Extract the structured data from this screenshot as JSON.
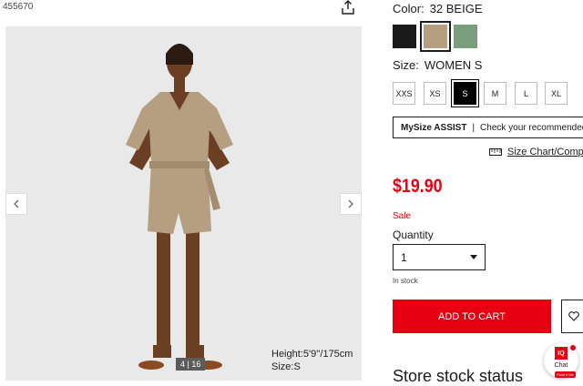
{
  "product_id": "455670",
  "gallery": {
    "counter": "4 | 16",
    "model_height": "Height:5'9''/175cm",
    "model_size": "Size:S",
    "prev_icon": "chevron-left-icon",
    "next_icon": "chevron-right-icon"
  },
  "color": {
    "label": "Color:",
    "value": "32 BEIGE",
    "swatches": [
      {
        "name": "black",
        "hex": "#1a1a1a"
      },
      {
        "name": "beige",
        "hex": "#b59f80",
        "selected": true
      },
      {
        "name": "green",
        "hex": "#7a9e7e"
      }
    ]
  },
  "size": {
    "label": "Size:",
    "value": "WOMEN S",
    "options": [
      "XXS",
      "XS",
      "S",
      "M",
      "L",
      "XL"
    ],
    "selected": "S"
  },
  "mysize": {
    "brand": "MySize ASSIST",
    "text": "Check your recommended size"
  },
  "size_chart": {
    "label": "Size Chart/Compare",
    "icon": "ruler-icon"
  },
  "price": "$19.90",
  "sale_label": "Sale",
  "quantity": {
    "label": "Quantity",
    "value": "1"
  },
  "stock_status": "In stock",
  "add_to_cart": "ADD TO CART",
  "favorite_icon": "heart-icon",
  "store_stock_heading": "Store stock status",
  "chat": {
    "badge": "IQ",
    "label": "Chat",
    "pill": "Point it Me"
  },
  "colors": {
    "accent": "#e60012",
    "text": "#1b1b1b",
    "photo_bg": "#e9e9e9"
  }
}
